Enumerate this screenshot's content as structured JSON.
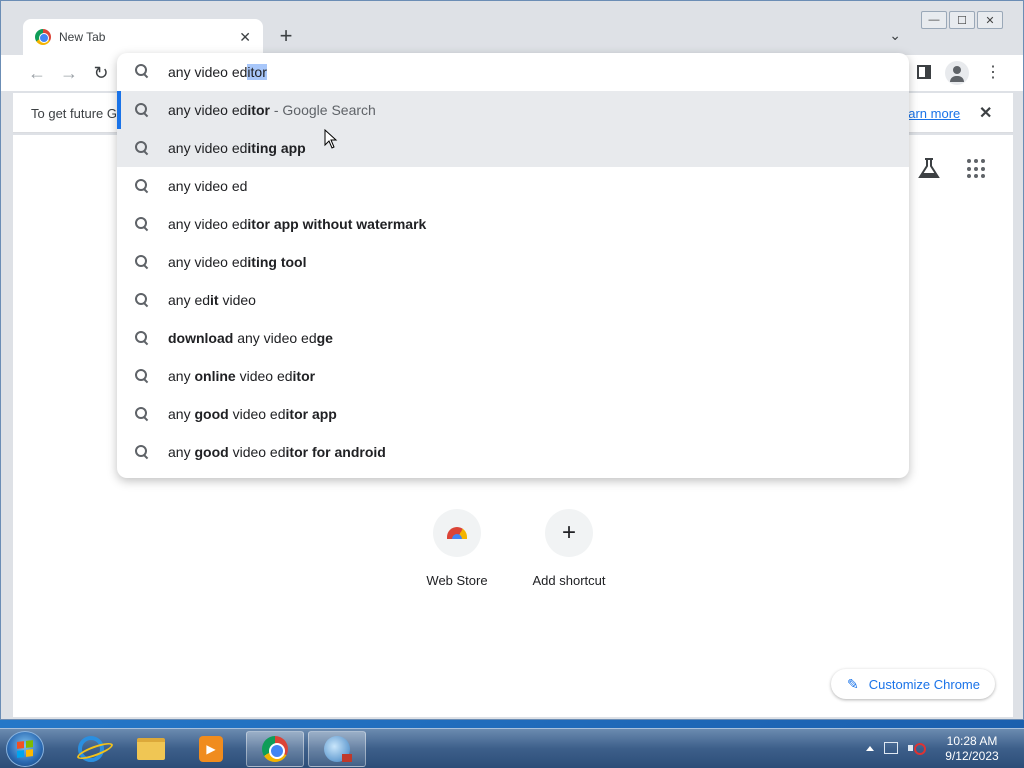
{
  "browser": {
    "tab": {
      "title": "New Tab",
      "close_glyph": "✕"
    },
    "new_tab_glyph": "+",
    "tab_search_glyph": "⌄",
    "window_controls": {
      "minimize": "—",
      "maximize": "☐",
      "close": "✕"
    },
    "nav": {
      "back": "←",
      "forward": "→",
      "reload": "↻"
    },
    "menu_glyph": "⋮"
  },
  "omnibox": {
    "typed": "any video ed",
    "autocomplete": "itor",
    "suggestions": [
      {
        "parts": [
          {
            "t": "any video ed",
            "b": false
          },
          {
            "t": "itor",
            "b": true
          }
        ],
        "suffix": " - Google Search"
      },
      {
        "parts": [
          {
            "t": "any video ed",
            "b": false
          },
          {
            "t": "iting app",
            "b": true
          }
        ]
      },
      {
        "parts": [
          {
            "t": "any video ed",
            "b": false
          }
        ]
      },
      {
        "parts": [
          {
            "t": "any video ed",
            "b": false
          },
          {
            "t": "itor app without watermark",
            "b": true
          }
        ]
      },
      {
        "parts": [
          {
            "t": "any video ed",
            "b": false
          },
          {
            "t": "iting tool",
            "b": true
          }
        ]
      },
      {
        "parts": [
          {
            "t": "any ed",
            "b": false
          },
          {
            "t": "it",
            "b": true
          },
          {
            "t": " video",
            "b": false
          }
        ]
      },
      {
        "parts": [
          {
            "t": "download",
            "b": true
          },
          {
            "t": " any video ed",
            "b": false
          },
          {
            "t": "ge",
            "b": true
          }
        ]
      },
      {
        "parts": [
          {
            "t": "any ",
            "b": false
          },
          {
            "t": "online",
            "b": true
          },
          {
            "t": " video ed",
            "b": false
          },
          {
            "t": "itor",
            "b": true
          }
        ]
      },
      {
        "parts": [
          {
            "t": "any ",
            "b": false
          },
          {
            "t": "good",
            "b": true
          },
          {
            "t": " video ed",
            "b": false
          },
          {
            "t": "itor app",
            "b": true
          }
        ]
      },
      {
        "parts": [
          {
            "t": "any ",
            "b": false
          },
          {
            "t": "good",
            "b": true
          },
          {
            "t": " video ed",
            "b": false
          },
          {
            "t": "itor for android",
            "b": true
          }
        ]
      }
    ]
  },
  "infobar": {
    "text": "To get future G",
    "link": "earn more",
    "close_glyph": "✕"
  },
  "shortcuts": [
    {
      "label": "Web Store"
    },
    {
      "label": "Add shortcut",
      "glyph": "+"
    }
  ],
  "customize": {
    "label": "Customize Chrome",
    "glyph": "✎"
  },
  "taskbar": {
    "clock_time": "10:28 AM",
    "clock_date": "9/12/2023"
  },
  "colors": {
    "accent": "#1a73e8",
    "selection": "#a8c7fa",
    "highlight_row": "#e8eaed"
  }
}
